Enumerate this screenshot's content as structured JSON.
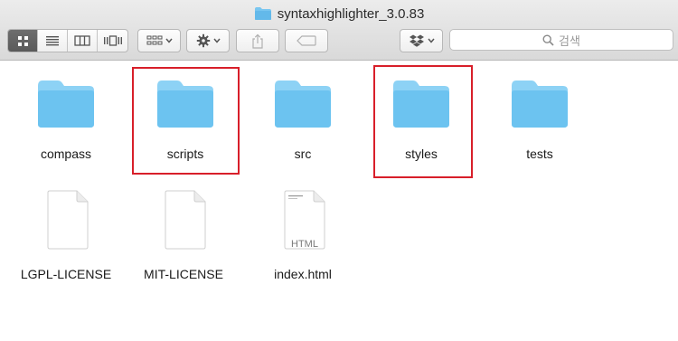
{
  "window": {
    "title": "syntaxhighlighter_3.0.83"
  },
  "toolbar": {
    "view_buttons": [
      "icon-view",
      "list-view",
      "column-view",
      "cover-flow-view"
    ],
    "active_view": "icon-view",
    "arrange_button": "arrange-menu",
    "action_button": "action-menu",
    "share_button": "share",
    "tag_button": "tags",
    "dropbox_button": "dropbox-menu"
  },
  "search": {
    "placeholder": "검색"
  },
  "items": [
    {
      "name": "compass",
      "kind": "folder"
    },
    {
      "name": "scripts",
      "kind": "folder",
      "highlighted": true
    },
    {
      "name": "src",
      "kind": "folder"
    },
    {
      "name": "styles",
      "kind": "folder",
      "highlighted": true
    },
    {
      "name": "tests",
      "kind": "folder"
    },
    {
      "name": "LGPL-LICENSE",
      "kind": "file"
    },
    {
      "name": "MIT-LICENSE",
      "kind": "file"
    },
    {
      "name": "index.html",
      "kind": "html-file",
      "badge": "HTML"
    }
  ],
  "colors": {
    "folder": "#6cc3f0",
    "folder_tab": "#8dd2f5",
    "highlight": "#d81f2a"
  }
}
